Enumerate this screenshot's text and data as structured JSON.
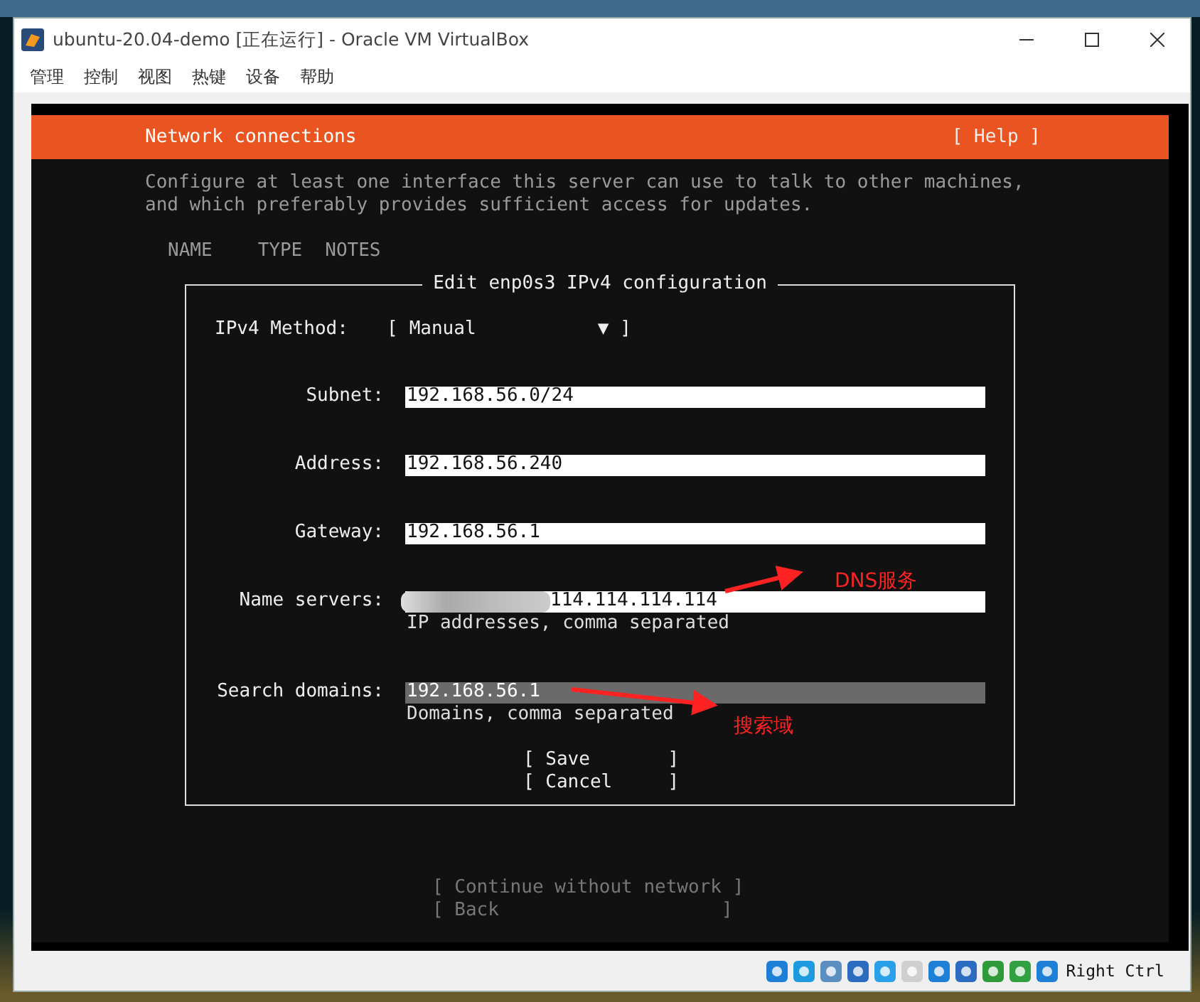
{
  "window": {
    "title": "ubuntu-20.04-demo [正在运行] - Oracle VM VirtualBox",
    "menu": [
      "管理",
      "控制",
      "视图",
      "热键",
      "设备",
      "帮助"
    ]
  },
  "screen": {
    "header": {
      "title": "Network connections",
      "help": "[ Help ]"
    },
    "intro": "Configure at least one interface this server can use to talk to other machines, and which preferably provides sufficient access for updates.",
    "columns": [
      "NAME",
      "TYPE",
      "NOTES"
    ],
    "dialog": {
      "title": "Edit enp0s3 IPv4 configuration",
      "method": {
        "label": "IPv4 Method:",
        "open": "[",
        "value": "Manual",
        "arrow": "▼",
        "close": "]"
      },
      "fields": [
        {
          "label": "Subnet:",
          "value": "192.168.56.0/24",
          "focused": false,
          "redacted": false
        },
        {
          "label": "Address:",
          "value": "192.168.56.240",
          "focused": false,
          "redacted": false
        },
        {
          "label": "Gateway:",
          "value": "192.168.56.1",
          "focused": false,
          "redacted": false
        },
        {
          "label": "Name servers:",
          "value": "114.114.114.114",
          "hint": "IP addresses, comma separated",
          "focused": false,
          "redacted": true
        },
        {
          "label": "Search domains:",
          "value": "192.168.56.1",
          "hint": "Domains, comma separated",
          "focused": true,
          "redacted": false
        }
      ],
      "buttons": [
        "[ Save       ]",
        "[ Cancel     ]"
      ]
    },
    "footer_buttons": [
      {
        "label": "[ Continue without network ]",
        "disabled": true
      },
      {
        "label": "[ Back                    ]",
        "disabled": true
      }
    ]
  },
  "annotations": [
    "DNS服务",
    "搜索域"
  ],
  "status_bar": {
    "host_key": "Right Ctrl"
  }
}
